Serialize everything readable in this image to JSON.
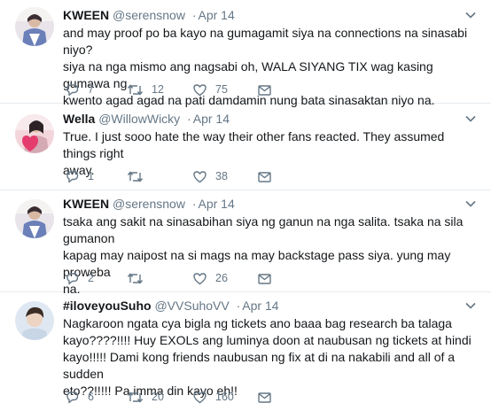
{
  "tweets": [
    {
      "name": "KWEEN",
      "handle": "@serensnow",
      "date": "Apr 14",
      "lines": [
        "and may proof po ba kayo na gumagamit siya na connections na sinasabi niyo?",
        "siya na nga mismo ang nagsabi oh, WALA SIYANG TIX wag kasing gumawa ng",
        "kwento agad agad na pati damdamin nung bata sinasaktan niyo na."
      ],
      "replies": "7",
      "retweets": "12",
      "likes": "75"
    },
    {
      "name": "Wella",
      "handle": "@WillowWicky",
      "date": "Apr 14",
      "lines": [
        "True. I just sooo hate the way their other fans reacted. They assumed things right",
        "away."
      ],
      "replies": "1",
      "retweets": "",
      "likes": "38"
    },
    {
      "name": "KWEEN",
      "handle": "@serensnow",
      "date": "Apr 14",
      "lines": [
        "tsaka ang sakit na sinasabihan siya ng ganun na nga salita. tsaka na sila gumanon",
        "kapag may naipost na si mags na may backstage pass siya. yung may proweba",
        "na."
      ],
      "replies": "2",
      "retweets": "",
      "likes": "26"
    },
    {
      "name": "#iloveyouSuho",
      "handle": "@VVSuhoVV",
      "date": "Apr 14",
      "lines": [
        "Nagkaroon ngata cya bigla ng tickets ano baaa bag research ba talaga",
        "kayo????!!!! Huy EXOLs ang luminya doon at naubusan ng tickets at hindi",
        "kayo!!!!! Dami kong friends naubusan ng fix at di na nakabili and all of a sudden",
        "eto??!!!!! Pa imma din kayo eh!!"
      ],
      "replies": "6",
      "retweets": "20",
      "likes": "160"
    }
  ],
  "colors": {
    "text": "#14171a",
    "secondary": "#657786",
    "divider": "#e6ecf0"
  }
}
